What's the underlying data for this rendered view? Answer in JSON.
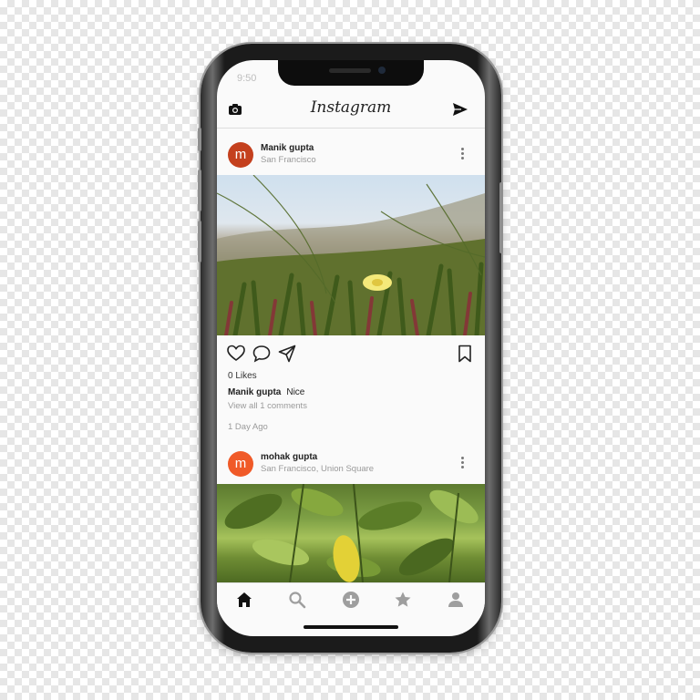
{
  "status_bar": {
    "time": "9:50"
  },
  "header": {
    "logo": "Instagram"
  },
  "posts": [
    {
      "avatar_letter": "m",
      "username": "Manik gupta",
      "location": "San Francisco",
      "likes": "0 Likes",
      "caption_user": "Manik gupta",
      "caption_text": "Nice",
      "comments_link": "View all 1 comments",
      "age": "1 Day Ago"
    },
    {
      "avatar_letter": "m",
      "username": "mohak gupta",
      "location": "San Francisco, Union Square"
    }
  ],
  "icons": {
    "header_left": "camera-icon",
    "header_right": "send-icon",
    "actions": [
      "heart-icon",
      "comment-icon",
      "share-icon",
      "bookmark-icon"
    ],
    "tabs": [
      "home-icon",
      "search-icon",
      "add-icon",
      "star-icon",
      "profile-icon"
    ]
  },
  "colors": {
    "avatar_1": "#c4401e",
    "avatar_2": "#f05a28",
    "accent_dark": "#222222"
  }
}
